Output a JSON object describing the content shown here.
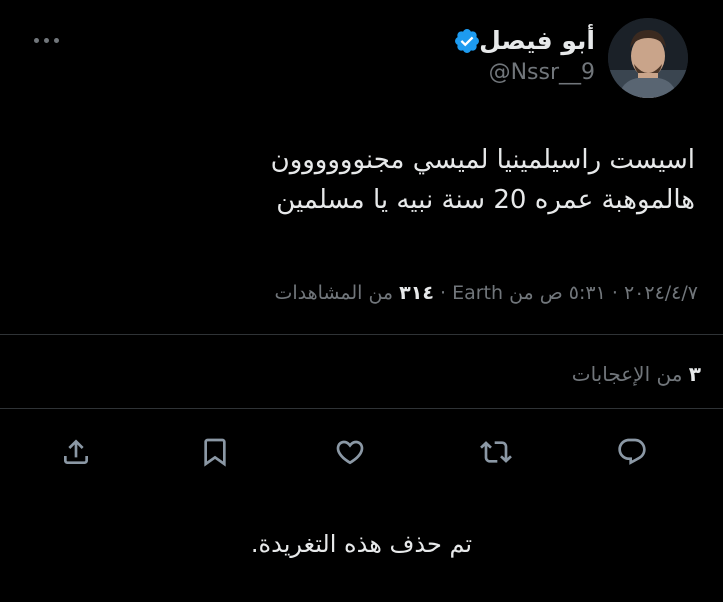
{
  "header": {
    "display_name": "أبو فيصل",
    "handle": "@Nssr__9",
    "more_label": "More"
  },
  "tweet": {
    "text_line1": "اسيست راسيلمينيا لميسي مجنوووووون",
    "text_line2": "هالموهبة عمره 20 سنة نبيه يا مسلمين",
    "date": "٢٠٢٤/٤/٧",
    "time": "٥:٣١ ص",
    "location_prefix": "من",
    "location": "Earth",
    "views_count": "٣١٤",
    "views_label": "من المشاهدات",
    "separator": "·"
  },
  "engagement": {
    "likes_count": "٣",
    "likes_label": "من الإعجابات"
  },
  "actions": {
    "reply_icon": "reply-icon",
    "retweet_icon": "retweet-icon",
    "like_icon": "heart-icon",
    "bookmark_icon": "bookmark-icon",
    "share_icon": "share-icon"
  },
  "status": {
    "deleted_message": "تم حذف هذه التغريدة."
  },
  "colors": {
    "background": "#000000",
    "primary_text": "#e7e9ea",
    "secondary_text": "#71767b",
    "verified": "#1d9bf0",
    "divider": "#2f3336"
  }
}
